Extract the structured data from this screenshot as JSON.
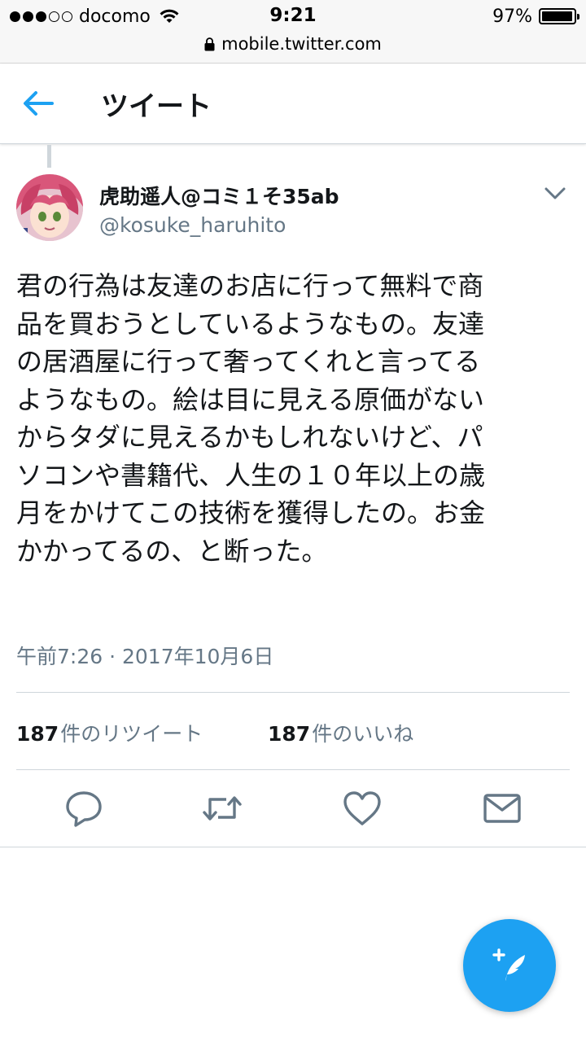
{
  "status_bar": {
    "carrier": "docomo",
    "time": "9:21",
    "battery_text": "97%",
    "battery_level": 0.97,
    "url": "mobile.twitter.com"
  },
  "header": {
    "title": "ツイート"
  },
  "tweet": {
    "display_name": "虎助遥人@コミ１そ35ab",
    "handle": "@kosuke_haruhito",
    "text": "君の行為は友達のお店に行って無料で商\n品を買おうとしているようなもの。友達\nの居酒屋に行って奢ってくれと言ってる\nようなもの。絵は目に見える原価がない\nからタダに見えるかもしれないけど、パ\nソコンや書籍代、人生の１０年以上の歳\n月をかけてこの技術を獲得したの。お金\nかかってるの、と断った。",
    "timestamp": "午前7:26 · 2017年10月6日",
    "retweet_count": "187",
    "retweet_label": "件のリツイート",
    "like_count": "187",
    "like_label": "件のいいね"
  },
  "icons": {
    "back": "back-arrow-icon",
    "menu": "chevron-down-icon",
    "reply": "reply-icon",
    "retweet": "retweet-icon",
    "like": "heart-icon",
    "dm": "envelope-icon",
    "compose": "compose-feather-icon"
  },
  "colors": {
    "accent": "#1da1f2",
    "text": "#14171a",
    "secondary": "#657786",
    "divider": "#cfd6db"
  }
}
